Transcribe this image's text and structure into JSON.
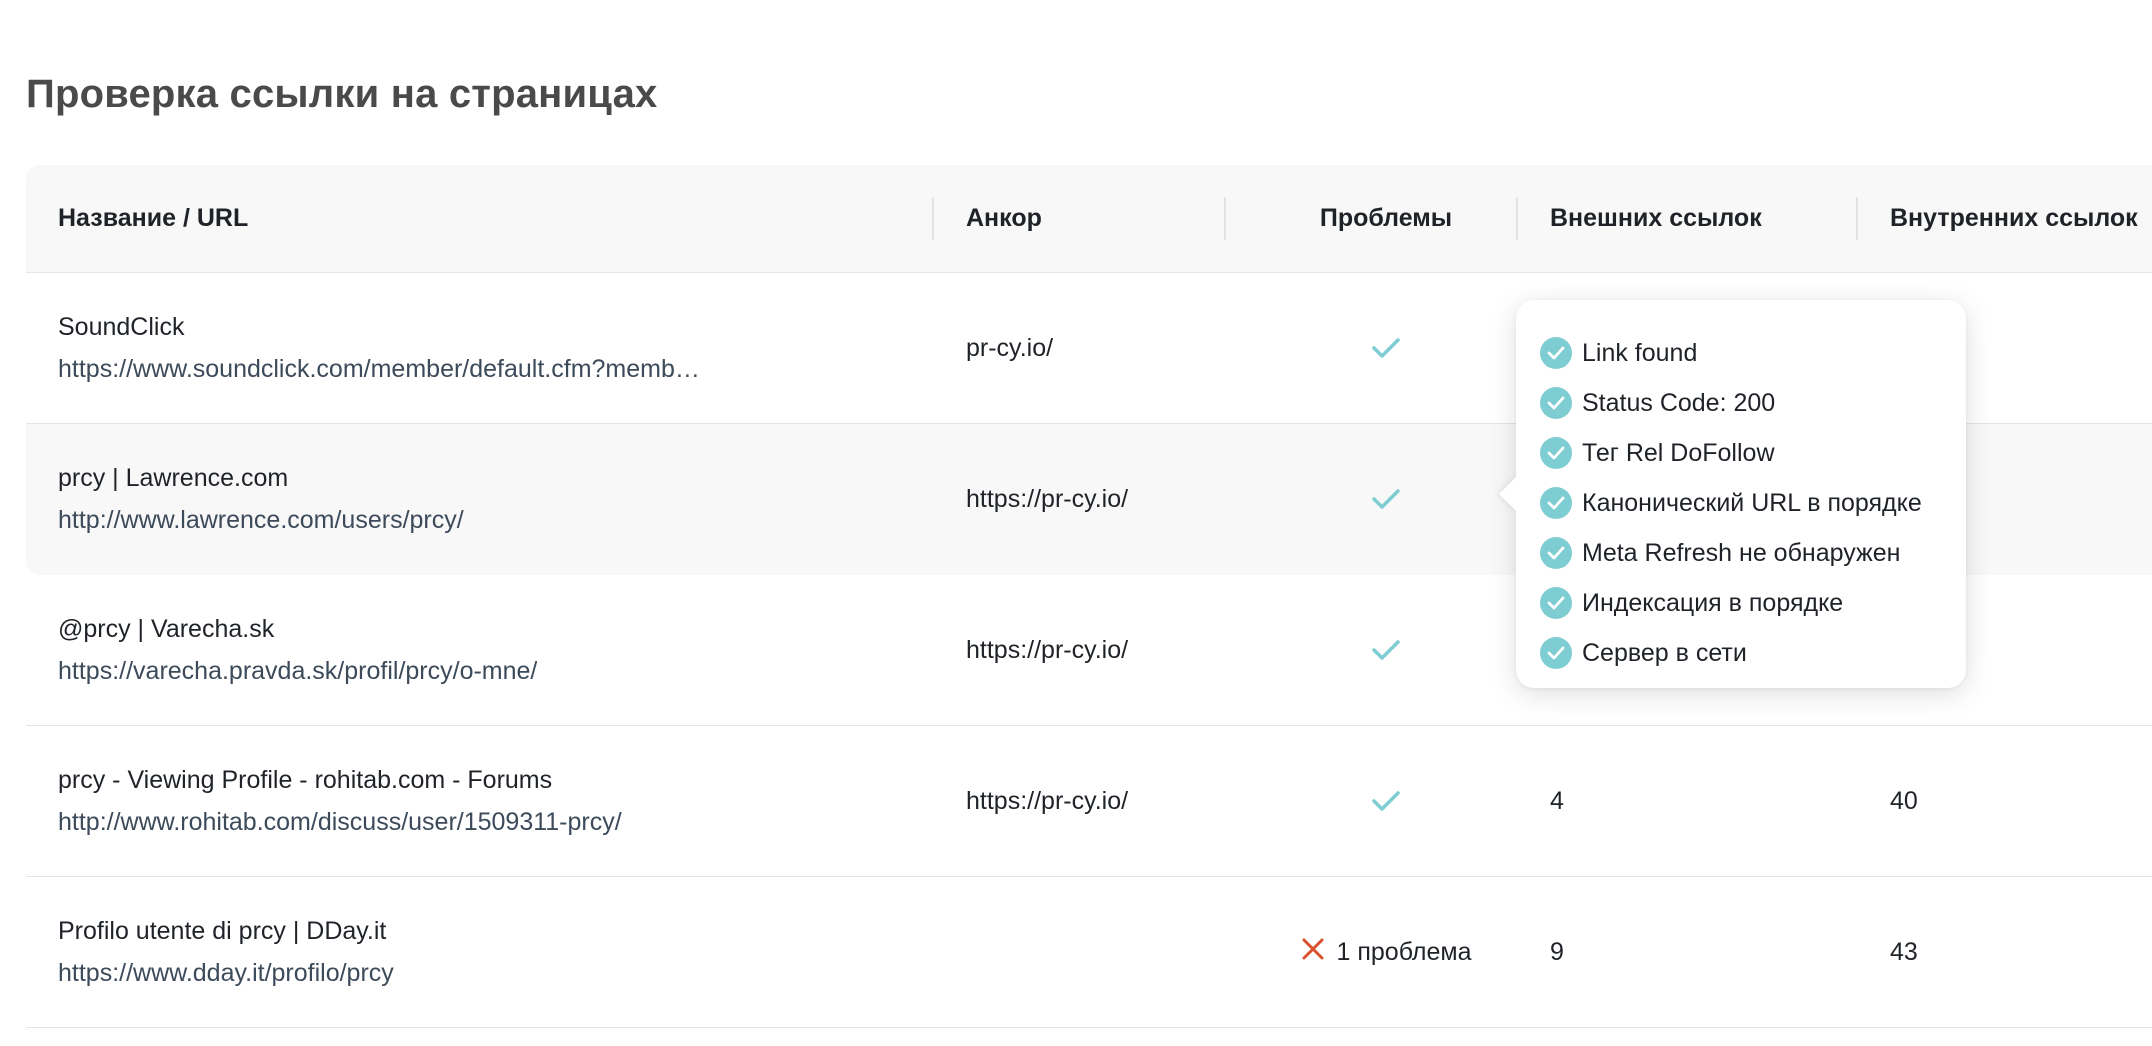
{
  "page": {
    "title": "Проверка ссылки на страницах"
  },
  "table": {
    "columns": [
      "Название / URL",
      "Анкор",
      "Проблемы",
      "Внешних ссылок",
      "Внутренних ссылок"
    ],
    "rows": [
      {
        "name": "SoundClick",
        "url": "https://www.soundclick.com/member/default.cfm?memb…",
        "anchor": "pr-cy.io/",
        "problems_ok": true,
        "problems_text": "",
        "external": "",
        "internal": ""
      },
      {
        "name": "prcy | Lawrence.com",
        "url": "http://www.lawrence.com/users/prcy/",
        "anchor": "https://pr-cy.io/",
        "problems_ok": true,
        "problems_text": "",
        "external": "",
        "internal": ""
      },
      {
        "name": "@prcy | Varecha.sk",
        "url": "https://varecha.pravda.sk/profil/prcy/o-mne/",
        "anchor": "https://pr-cy.io/",
        "problems_ok": true,
        "problems_text": "",
        "external": "",
        "internal": ""
      },
      {
        "name": "prcy - Viewing Profile - rohitab.com - Forums",
        "url": "http://www.rohitab.com/discuss/user/1509311-prcy/",
        "anchor": "https://pr-cy.io/",
        "problems_ok": true,
        "problems_text": "",
        "external": "4",
        "internal": "40"
      },
      {
        "name": "Profilo utente di prcy | DDay.it",
        "url": "https://www.dday.it/profilo/prcy",
        "anchor": "",
        "problems_ok": false,
        "problems_text": "1 проблема",
        "external": "9",
        "internal": "43"
      }
    ]
  },
  "tooltip": {
    "items": [
      "Link found",
      "Status Code: 200",
      "Тег Rel DoFollow",
      "Канонический URL в порядке",
      "Meta Refresh не обнаружен",
      "Индексация в порядке",
      "Сервер в сети"
    ]
  },
  "colors": {
    "check": "#7ecdd3",
    "error": "#d9512c",
    "url": "#3c4a5a"
  },
  "icons": {
    "ok": "check-icon",
    "error": "cross-icon",
    "tooltip_item": "check-circle-icon"
  }
}
